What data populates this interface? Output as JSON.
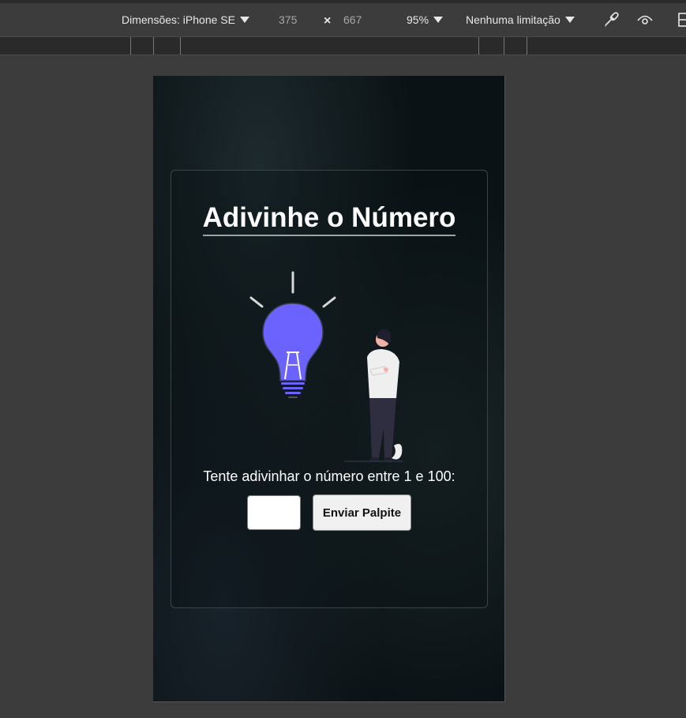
{
  "devtools": {
    "dimensions_label": "Dimensões: iPhone SE",
    "width_value": "375",
    "separator": "×",
    "height_value": "667",
    "zoom": "95%",
    "throttling": "Nenhuma limitação"
  },
  "game": {
    "title": "Adivinhe o Número",
    "prompt": "Tente adivinhar o número entre 1 e 100:",
    "input_value": "",
    "submit_label": "Enviar Palpite"
  },
  "colors": {
    "bulb": "#6c63ff",
    "background": "#0b1215",
    "text": "#ffffff"
  }
}
